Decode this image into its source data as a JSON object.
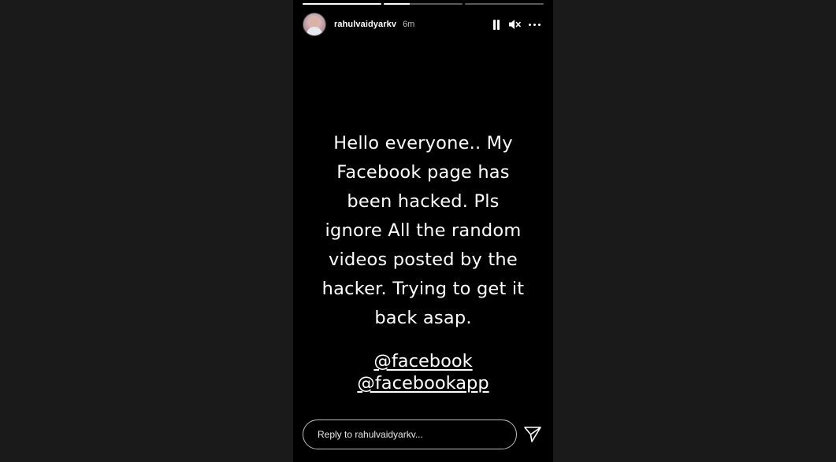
{
  "story": {
    "progress": [
      1,
      0.33,
      0
    ],
    "header": {
      "username": "rahulvaidyarkv",
      "time": "6m",
      "icons": [
        "pause-icon",
        "mute-icon",
        "more-options-icon"
      ]
    },
    "message_lines": [
      "Hello everyone.. My",
      "Facebook page has",
      "been hacked. Pls",
      "ignore All the random",
      "videos posted by the",
      "hacker. Trying to get it",
      "back asap."
    ],
    "mentions": [
      "@facebook",
      "@facebookapp"
    ],
    "reply": {
      "placeholder": "Reply to rahulvaidyarkv...",
      "send_icon": "send-icon"
    }
  },
  "colors": {
    "page_background": "#1a1a1a",
    "story_background": "#000000",
    "text": "#ffffff"
  }
}
